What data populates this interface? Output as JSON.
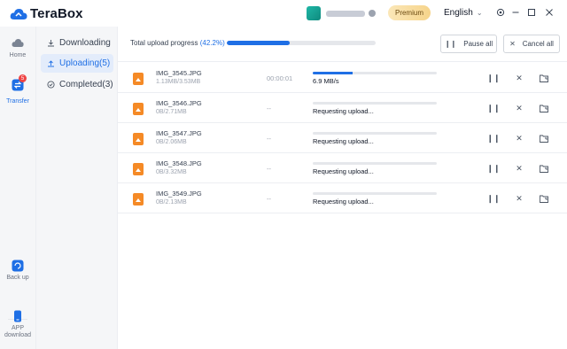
{
  "app": {
    "name": "TeraBox",
    "brand_color": "#1f6fe5"
  },
  "titlebar": {
    "premium_label": "Premium",
    "language": "English",
    "icons": [
      "settings-icon",
      "minimize-icon",
      "maximize-icon",
      "close-icon"
    ]
  },
  "rail": {
    "items": [
      {
        "label": "Home",
        "icon": "cloud-icon"
      },
      {
        "label": "Transfer",
        "icon": "transfer-icon",
        "badge": "5"
      },
      {
        "label": "Back up",
        "icon": "backup-icon"
      },
      {
        "label": "APP download",
        "icon": "phone-icon"
      }
    ]
  },
  "sidebar": {
    "items": [
      {
        "label": "Downloading",
        "icon": "download-icon"
      },
      {
        "label": "Uploading(5)",
        "icon": "upload-icon"
      },
      {
        "label": "Completed(3)",
        "icon": "check-circle-icon"
      }
    ]
  },
  "toolbar": {
    "progress_label": "Total upload progress",
    "progress_pct": "(42.2%)",
    "progress_value": 42.2,
    "pause_all": "Pause all",
    "cancel_all": "Cancel all"
  },
  "uploads": [
    {
      "name": "IMG_3545.JPG",
      "size": "1.13MB/3.53MB",
      "eta": "00:00:01",
      "status": "6.9 MB/s",
      "progress": 0.32
    },
    {
      "name": "IMG_3546.JPG",
      "size": "0B/2.71MB",
      "eta": "--",
      "status": "Requesting upload...",
      "progress": 0
    },
    {
      "name": "IMG_3547.JPG",
      "size": "0B/2.06MB",
      "eta": "--",
      "status": "Requesting upload...",
      "progress": 0
    },
    {
      "name": "IMG_3548.JPG",
      "size": "0B/3.32MB",
      "eta": "--",
      "status": "Requesting upload...",
      "progress": 0
    },
    {
      "name": "IMG_3549.JPG",
      "size": "0B/2.13MB",
      "eta": "--",
      "status": "Requesting upload...",
      "progress": 0
    }
  ]
}
